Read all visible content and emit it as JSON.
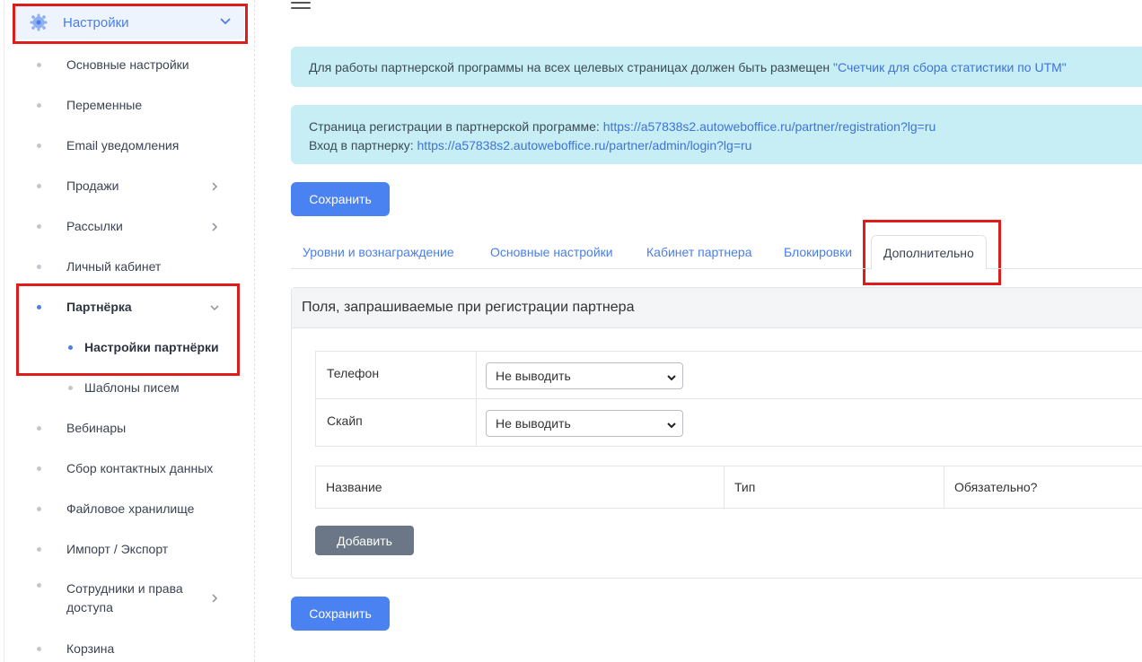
{
  "sidebar": {
    "header": {
      "title": "Настройки",
      "icon": "gear-icon"
    },
    "items": [
      {
        "label": "Основные настройки"
      },
      {
        "label": "Переменные"
      },
      {
        "label": "Email уведомления"
      },
      {
        "label": "Продажи",
        "expandable": true
      },
      {
        "label": "Рассылки",
        "expandable": true
      },
      {
        "label": "Личный кабинет"
      },
      {
        "label": "Партнёрка",
        "expanded": true,
        "active": true
      },
      {
        "label": "Настройки партнёрки",
        "sub": true,
        "active": true
      },
      {
        "label": "Шаблоны писем",
        "sub": true
      },
      {
        "label": "Вебинары"
      },
      {
        "label": "Сбор контактных данных"
      },
      {
        "label": "Файловое хранилище"
      },
      {
        "label": "Импорт / Экспорт"
      },
      {
        "label": "Сотрудники и права доступа",
        "expandable": true
      },
      {
        "label": "Корзина"
      }
    ]
  },
  "alerts": {
    "utm_text": "Для работы партнерской программы на всех целевых страницах должен быть размещен ",
    "utm_link": "\"Счетчик для сбора статистики по UTM\"",
    "registration_label": "Страница регистрации в партнерской программе: ",
    "registration_link": "https://a57838s2.autoweboffice.ru/partner/registration?lg=ru",
    "login_label": "Вход в партнерку: ",
    "login_link": "https://a57838s2.autoweboffice.ru/partner/admin/login?lg=ru"
  },
  "buttons": {
    "save": "Сохранить",
    "add": "Добавить"
  },
  "tabs": [
    {
      "label": "Уровни и вознаграждение"
    },
    {
      "label": "Основные настройки"
    },
    {
      "label": "Кабинет партнера"
    },
    {
      "label": "Блокировки"
    },
    {
      "label": "Дополнительно",
      "active": true
    }
  ],
  "card": {
    "title": "Поля, запрашиваемые при регистрации партнера",
    "fields": [
      {
        "label": "Телефон",
        "value": "Не выводить"
      },
      {
        "label": "Скайп",
        "value": "Не выводить"
      }
    ],
    "columns": [
      "Название",
      "Тип",
      "Обязательно?"
    ]
  },
  "colors": {
    "accent": "#4b82f1",
    "alert_bg": "#c7eef4",
    "highlight": "#dd1c1c",
    "secondary_button": "#6b7787"
  }
}
